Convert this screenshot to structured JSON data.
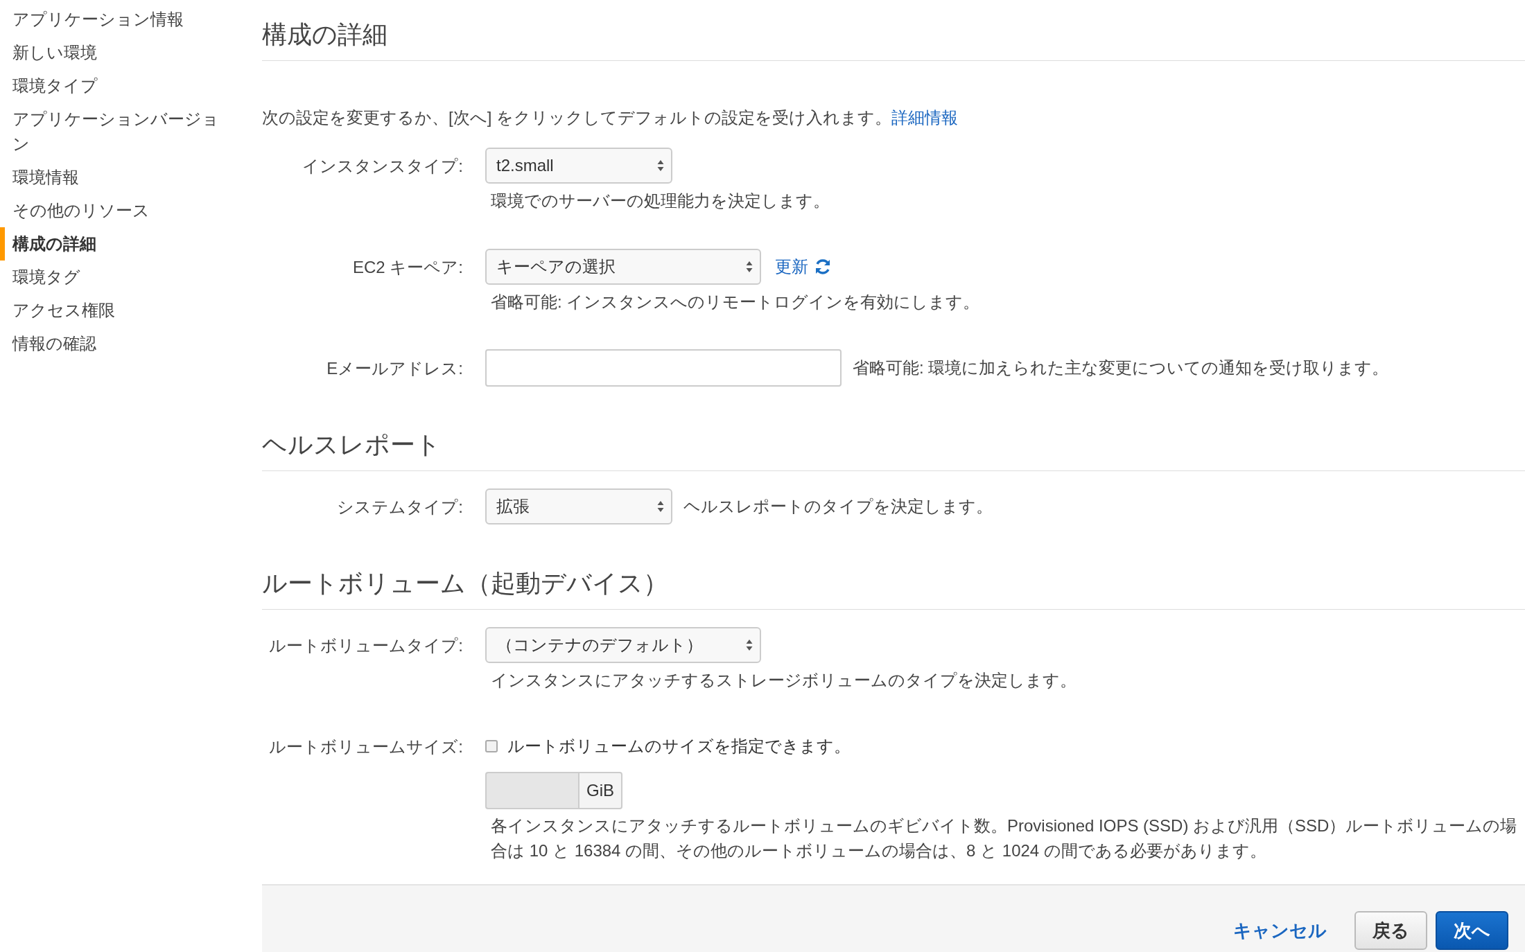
{
  "sidebar": {
    "items": [
      {
        "label": "アプリケーション情報",
        "selected": false
      },
      {
        "label": "新しい環境",
        "selected": false
      },
      {
        "label": "環境タイプ",
        "selected": false
      },
      {
        "label": "アプリケーションバージョン",
        "selected": false
      },
      {
        "label": "環境情報",
        "selected": false
      },
      {
        "label": "その他のリソース",
        "selected": false
      },
      {
        "label": "構成の詳細",
        "selected": true
      },
      {
        "label": "環境タグ",
        "selected": false
      },
      {
        "label": "アクセス権限",
        "selected": false
      },
      {
        "label": "情報の確認",
        "selected": false
      }
    ]
  },
  "sections": [
    {
      "title": "構成の詳細",
      "intro": "次の設定を変更するか、[次へ] をクリックしてデフォルトの設定を受け入れます。",
      "intro_link": "詳細情報",
      "fields": [
        {
          "kind": "select",
          "label": "インスタンスタイプ:",
          "value": "t2.small",
          "help": "環境でのサーバーの処理能力を決定します。",
          "help_inline": false
        },
        {
          "kind": "select-wide",
          "label": "EC2 キーペア:",
          "value": "キーペアの選択",
          "refresh_link": "更新",
          "help": "省略可能: インスタンスへのリモートログインを有効にします。",
          "help_inline": false
        },
        {
          "kind": "text-input",
          "label": "Eメールアドレス:",
          "help": "省略可能: 環境に加えられた主な変更についての通知を受け取ります。",
          "help_inline": true
        }
      ]
    },
    {
      "title": "ヘルスレポート",
      "fields": [
        {
          "kind": "select",
          "label": "システムタイプ:",
          "value": "拡張",
          "help": "ヘルスレポートのタイプを決定します。",
          "help_inline": true
        }
      ]
    },
    {
      "title": "ルートボリューム（起動デバイス）",
      "fields": [
        {
          "kind": "select-wide",
          "label": "ルートボリュームタイプ:",
          "value": "（コンテナのデフォルト）",
          "help": "インスタンスにアタッチするストレージボリュームのタイプを決定します。",
          "help_inline": false
        },
        {
          "kind": "checkbox",
          "label": "ルートボリュームサイズ:",
          "checkbox_label": "ルートボリュームのサイズを指定できます。",
          "checked": false,
          "unit": "GiB",
          "help": "各インスタンスにアタッチするルートボリュームのギビバイト数。Provisioned IOPS (SSD) および汎用（SSD）ルートボリュームの場合は 10 と 16384 の間、その他のルートボリュームの場合は、8 と 1024 の間である必要があります。",
          "help_inline": false
        }
      ]
    }
  ],
  "footer": {
    "cancel": "キャンセル",
    "back": "戻る",
    "next": "次へ"
  }
}
